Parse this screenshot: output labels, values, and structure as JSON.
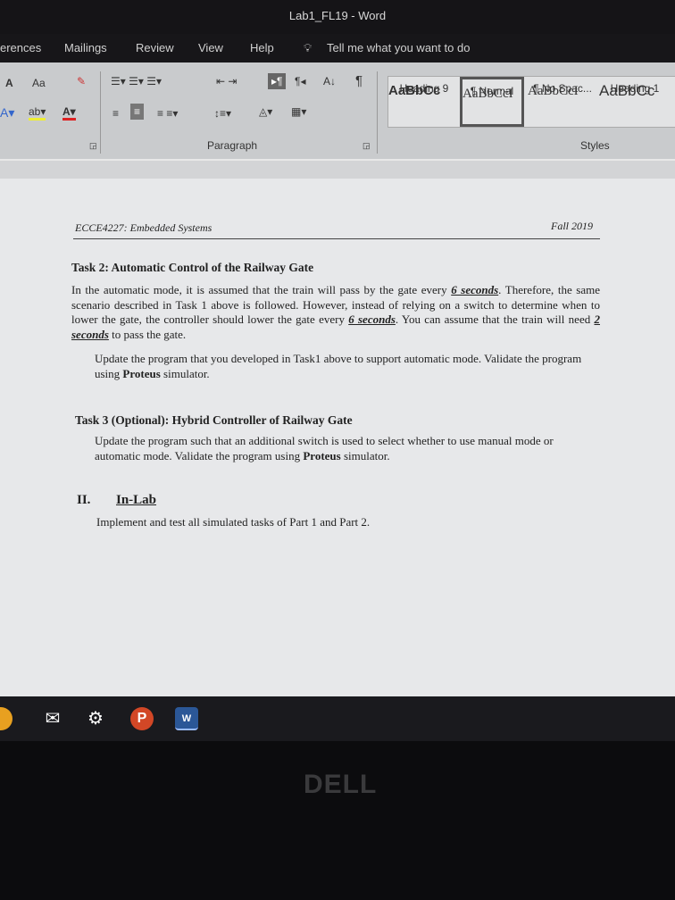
{
  "window": {
    "title": "Lab1_FL19 - Word"
  },
  "tabs": [
    "erences",
    "Mailings",
    "Review",
    "View",
    "Help"
  ],
  "tell_me": "Tell me what you want to do",
  "ribbon": {
    "font_case": "Aa",
    "paragraph_group": "Paragraph",
    "styles_group": "Styles",
    "styles": [
      {
        "preview": "AaBbCc",
        "name": "Heading 9"
      },
      {
        "preview": "AaBbCcI",
        "name": "¶ Normal"
      },
      {
        "preview": "AaBbCcI",
        "name": "¶ No Spac..."
      },
      {
        "preview": "AaBbCc",
        "name": "Heading 1"
      }
    ]
  },
  "document": {
    "header_left": "ECCE4227: Embedded Systems",
    "header_right": "Fall 2019",
    "task2_title": "Task 2: Automatic Control of the Railway Gate",
    "task2_p1": [
      "In the automatic mode, it is assumed that the train will pass by the gate every ",
      "6 seconds",
      ". Therefore, the same scenario described in Task 1 above is followed. However, instead of relying on a switch to determine when to lower the gate, the controller should lower the gate every ",
      "6 seconds",
      ". You can assume that the train will need ",
      "2 seconds",
      " to pass the gate."
    ],
    "task2_p2": [
      "Update the program that you developed in Task1 above to support automatic mode. Validate the program using ",
      "Proteus",
      " simulator."
    ],
    "task3_title": "Task 3 (Optional): Hybrid Controller of Railway Gate",
    "task3_p": [
      "Update the program such that an additional switch is used to select whether to use manual mode or automatic mode. Validate the program using ",
      "Proteus",
      " simulator."
    ],
    "section_num": "II.",
    "section_title": "In-Lab",
    "section_p": "Implement and test all simulated tasks of Part 1 and Part 2."
  },
  "taskbar": {
    "icons": [
      "mail-icon",
      "settings-icon",
      "powerpoint-icon",
      "word-icon"
    ],
    "word_label": "W",
    "ppt_label": "P"
  },
  "bezel_logo": "DELL"
}
